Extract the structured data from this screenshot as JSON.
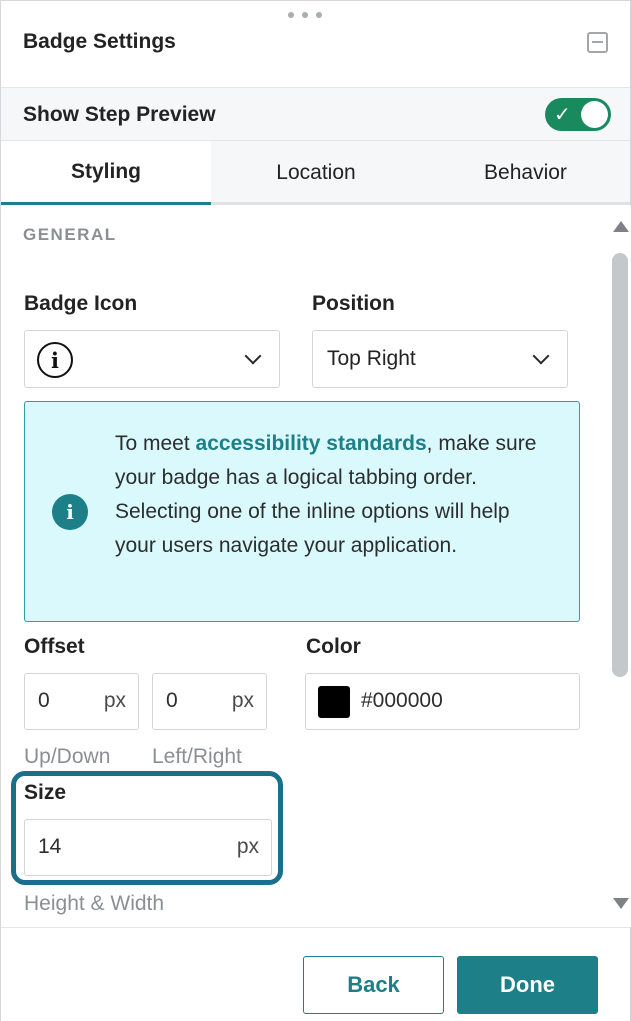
{
  "panel": {
    "title": "Badge Settings",
    "minimize_icon": "minimize-icon",
    "drag_icon": "drag-handle-icon"
  },
  "preview": {
    "label": "Show Step Preview",
    "toggle_on": true,
    "toggle_color": "#188a5e"
  },
  "tabs": [
    {
      "label": "Styling",
      "active": true
    },
    {
      "label": "Location",
      "active": false
    },
    {
      "label": "Behavior",
      "active": false
    }
  ],
  "general": {
    "section_title": "GENERAL",
    "badge_icon": {
      "label": "Badge Icon",
      "value_icon": "info-icon",
      "value_glyph": "i"
    },
    "position": {
      "label": "Position",
      "value": "Top Right"
    },
    "notice": {
      "prefix": "To meet ",
      "link": "accessibility standards",
      "suffix": ", make sure your badge has a logical tabbing order. Selecting one of the inline options will help your users navigate your application.",
      "icon": "info-icon"
    },
    "offset": {
      "label": "Offset",
      "up_down": {
        "value": "0",
        "unit": "px",
        "helper": "Up/Down"
      },
      "left_right": {
        "value": "0",
        "unit": "px",
        "helper": "Left/Right"
      }
    },
    "color": {
      "label": "Color",
      "value": "#000000",
      "swatch": "#000000"
    },
    "size": {
      "label": "Size",
      "value": "14",
      "unit": "px",
      "helper": "Height & Width"
    }
  },
  "footer": {
    "back_label": "Back",
    "done_label": "Done",
    "accent": "#1d7f87"
  }
}
